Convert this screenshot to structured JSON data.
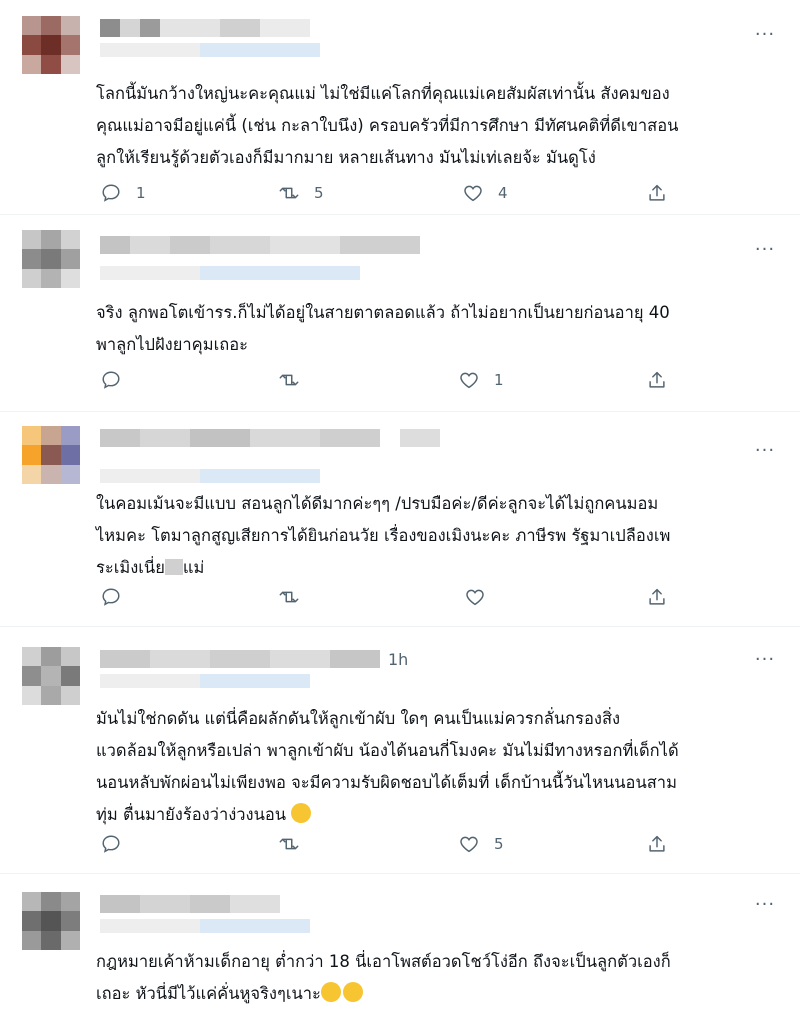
{
  "tweets": [
    {
      "lines": [
        "โลกนี้มันกว้างใหญ่นะคะคุณแม่ ไม่ใช่มีแค่โลกที่คุณแม่เคยสัมผัสเท่านั้น สังคมของ",
        "คุณแม่อาจมีอยู่แค่นี้ (เช่น กะลาใบนึง) ครอบครัวที่มีการศึกษา มีทัศนคติที่ดีเขาสอน",
        "ลูกให้เรียนรู้ด้วยตัวเองก็มีมากมาย หลายเส้นทาง มันไม่เท่เลยจ้ะ มันดูโง่"
      ],
      "replies": "1",
      "retweets": "5",
      "likes": "4",
      "time": ""
    },
    {
      "lines": [
        "จริง ลูกพอโตเข้ารร.ก็ไม่ได้อยู่ในสายตาตลอดแล้ว ถ้าไม่อยากเป็นยายก่อนอายุ 40",
        "พาลูกไปฝังยาคุมเถอะ"
      ],
      "replies": "",
      "retweets": "",
      "likes": "1",
      "time": ""
    },
    {
      "lines": [
        "ในคอมเม้นจะมีแบบ สอนลูกได้ดีมากค่ะๆๆ /ปรบมือค่ะ/ดีค่ะลูกจะได้ไม่ถูกคนมอม",
        "ไหมคะ   โตมาลูกสูญเสียการได้ยินก่อนวัย เรื่องของเมิงนะคะ ภาษีรพ รัฐมาเปลืองเพ",
        "ระเมิงเนี่ย"
      ],
      "line3_tail": "แม่",
      "replies": "",
      "retweets": "",
      "likes": "",
      "time": ""
    },
    {
      "lines": [
        "มันไม่ใช่กดดัน แต่นี่คือผลักดันให้ลูกเข้าผับ ใดๆ คนเป็นแม่ควรกลั่นกรองสิ่ง",
        "แวดล้อมให้ลูกหรือเปล่า พาลูกเข้าผับ น้องได้นอนกี่โมงคะ มันไม่มีทางหรอกที่เด็กได้",
        "นอนหลับพักผ่อนไม่เพียงพอ จะมีความรับผิดชอบได้เต็มที่ เด็กบ้านนี้วันไหนนอนสาม",
        "ทุ่ม ตื่นมายังร้องว่าง่วงนอน"
      ],
      "replies": "",
      "retweets": "",
      "likes": "5",
      "time": "1h"
    },
    {
      "lines": [
        "กฎหมายเค้าห้ามเด็กอายุ ต่ำกว่า 18 นี่เอาโพสต์อวดโชว์โง่อีก ถึงจะเป็นลูกตัวเองก็",
        "เถอะ หัวนี่มีไว้แค่คั่นหูจริงๆเนาะ"
      ],
      "replies": "",
      "retweets": "",
      "likes": "",
      "time": ""
    }
  ],
  "icons": {
    "reply": "reply-icon",
    "retweet": "retweet-icon",
    "like": "heart-icon",
    "share": "share-icon",
    "more": "more-icon"
  },
  "colors": {
    "text": "#0f1419",
    "muted": "#536471",
    "divider": "#eff3f4"
  }
}
